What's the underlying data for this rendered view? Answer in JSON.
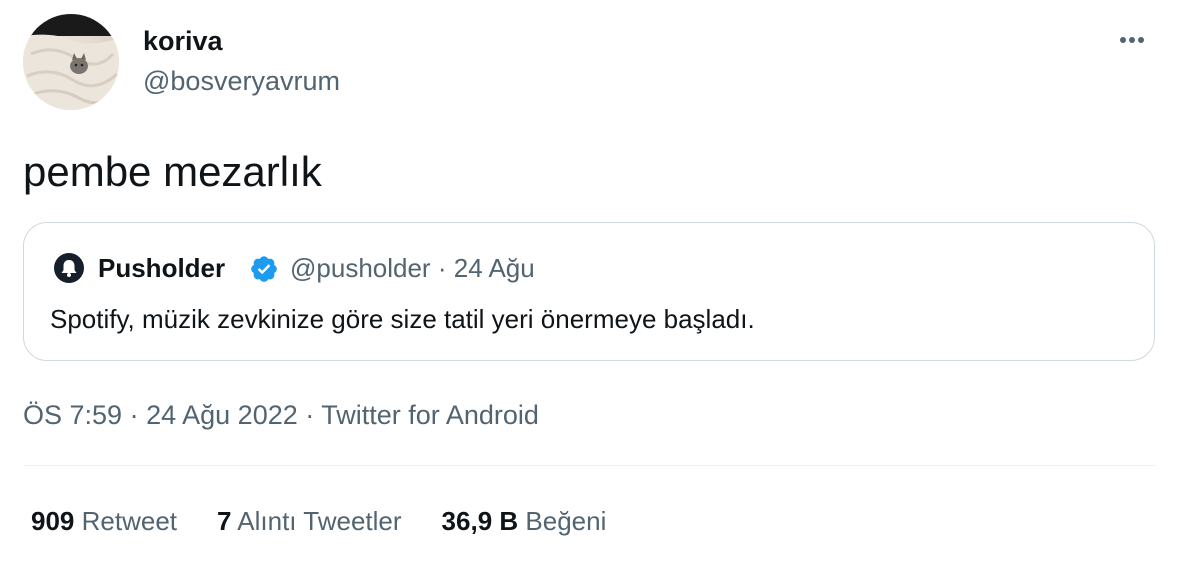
{
  "author": {
    "display_name": "koriva",
    "handle": "@bosveryavrum"
  },
  "tweet": {
    "text": "pembe mezarlık",
    "time": "ÖS 7:59",
    "separator": "·",
    "date": "24 Ağu 2022",
    "source": "Twitter for Android"
  },
  "quote": {
    "name": "Pusholder",
    "handle": "@pusholder",
    "separator": "·",
    "date": "24 Ağu",
    "text": "Spotify, müzik zevkinize göre size tatil yeri önermeye başladı."
  },
  "stats": {
    "retweets": {
      "count": "909",
      "label": "Retweet"
    },
    "quotes": {
      "count": "7",
      "label": "Alıntı Tweetler"
    },
    "likes": {
      "count": "36,9 B",
      "label": "Beğeni"
    }
  },
  "icons": {
    "more": "more-horizontal-icon",
    "verified": "verified-badge-icon",
    "quote_avatar": "bell-icon"
  },
  "colors": {
    "text_primary": "#0f1419",
    "text_secondary": "#536471",
    "border": "#cfd9de",
    "verified": "#1d9bf0"
  }
}
